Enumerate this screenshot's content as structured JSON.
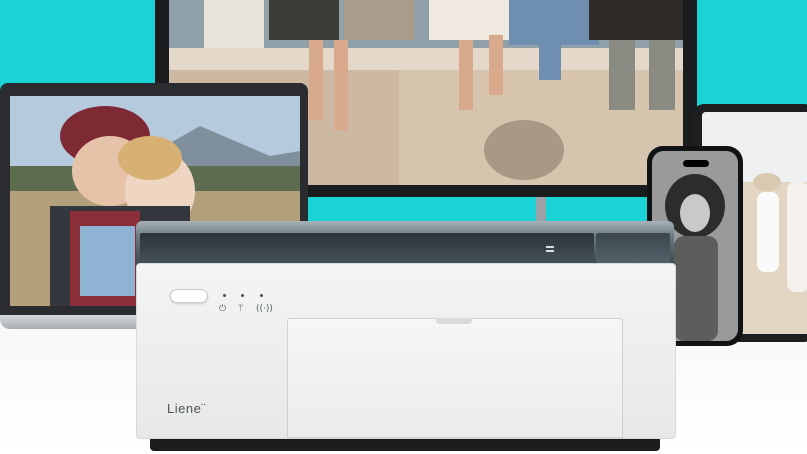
{
  "product": {
    "brand_logo": "Liene¨",
    "icons": [
      "power-icon",
      "wifi-icon",
      "nfc-icon"
    ]
  },
  "colors": {
    "background": "#19d3d6",
    "printer_top": "#3a4449",
    "printer_body": "#eeeeee"
  }
}
